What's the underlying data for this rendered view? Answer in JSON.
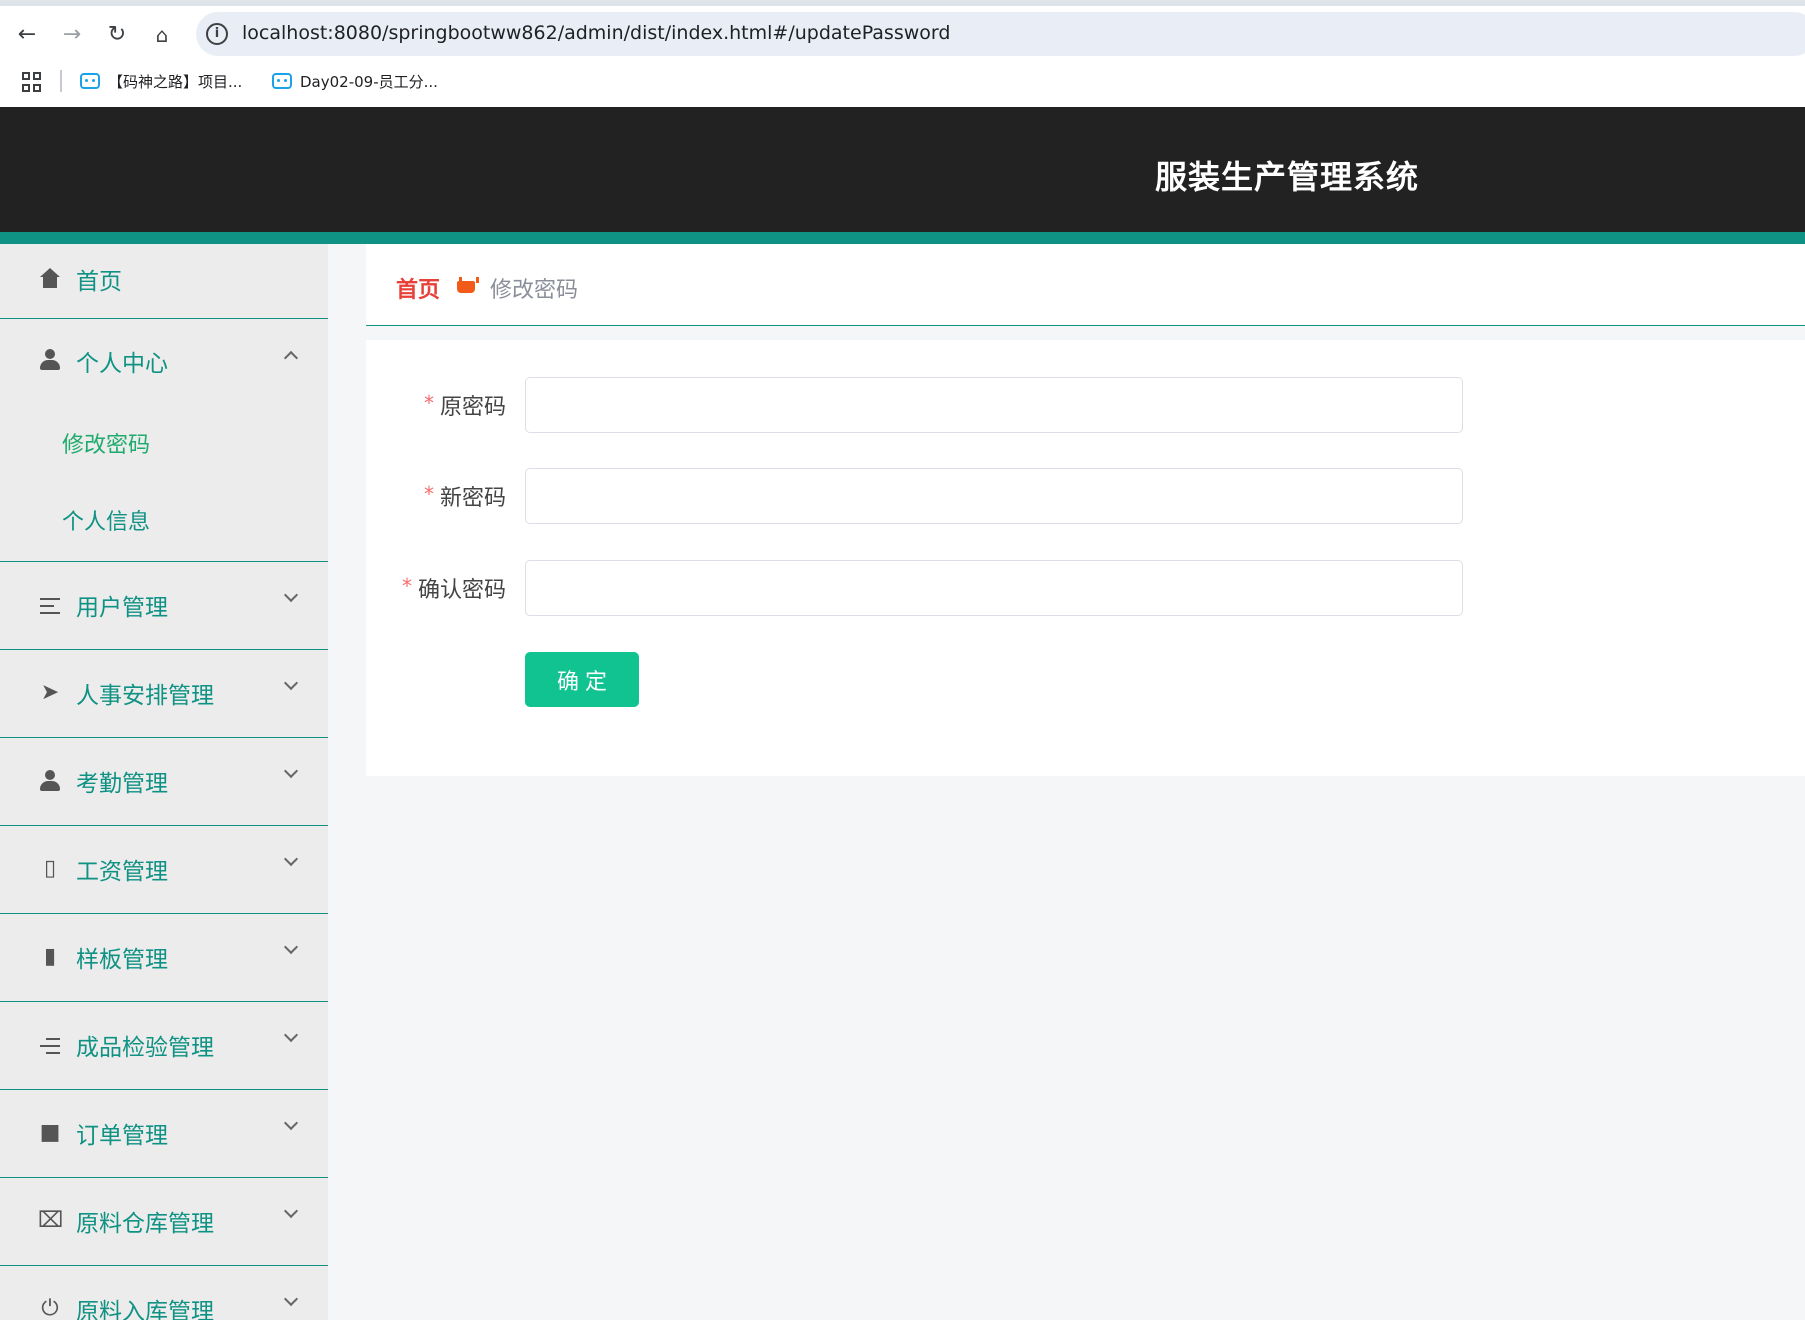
{
  "browser": {
    "url": "localhost:8080/springbootww862/admin/dist/index.html#/updatePassword",
    "bookmarks": [
      {
        "label": "【码神之路】项目..."
      },
      {
        "label": "Day02-09-员工分..."
      }
    ]
  },
  "header": {
    "title": "服装生产管理系统"
  },
  "sidebar": {
    "items": [
      {
        "label": "首页",
        "icon": "home-icon"
      },
      {
        "label": "个人中心",
        "icon": "user-icon",
        "expanded": true,
        "children": [
          {
            "label": "修改密码",
            "active": true
          },
          {
            "label": "个人信息"
          }
        ]
      },
      {
        "label": "用户管理",
        "icon": "list-icon"
      },
      {
        "label": "人事安排管理",
        "icon": "paper-plane-icon"
      },
      {
        "label": "考勤管理",
        "icon": "stamp-icon"
      },
      {
        "label": "工资管理",
        "icon": "thermometer-icon"
      },
      {
        "label": "样板管理",
        "icon": "ticket-icon"
      },
      {
        "label": "成品检验管理",
        "icon": "indent-icon"
      },
      {
        "label": "订单管理",
        "icon": "book-icon"
      },
      {
        "label": "原料仓库管理",
        "icon": "crop-icon"
      },
      {
        "label": "原料入库管理",
        "icon": "power-icon"
      }
    ]
  },
  "breadcrumb": {
    "home": "首页",
    "current": "修改密码"
  },
  "form": {
    "required_mark": "*",
    "fields": [
      {
        "label": "原密码",
        "value": ""
      },
      {
        "label": "新密码",
        "value": ""
      },
      {
        "label": "确认密码",
        "value": ""
      }
    ],
    "submit_label": "确定"
  },
  "colors": {
    "accent": "#0f9283",
    "header_bg": "#222222",
    "submit": "#10c390",
    "breadcrumb_home": "#e8413a",
    "active_submenu": "#1fab6d"
  }
}
